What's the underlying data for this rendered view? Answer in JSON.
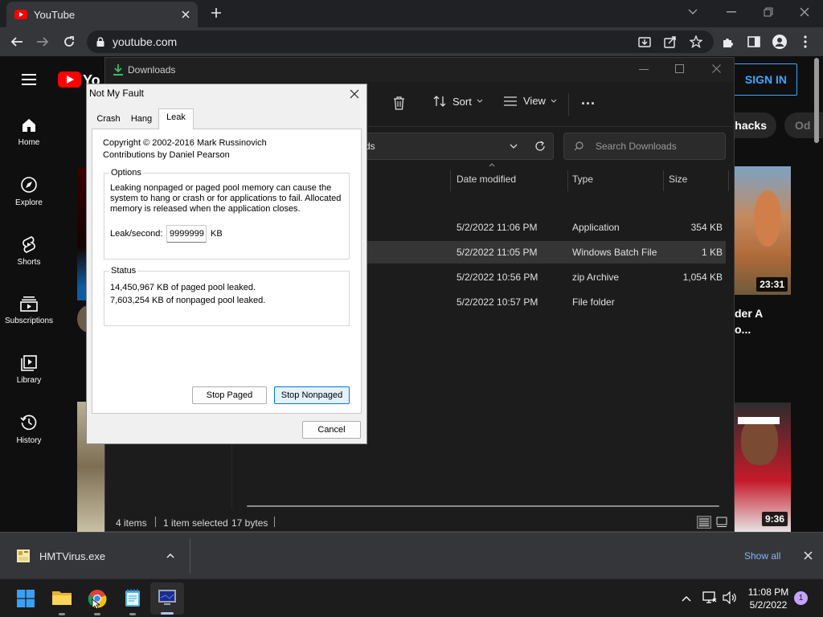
{
  "chrome": {
    "tab_title": "YouTube",
    "url": "youtube.com"
  },
  "youtube": {
    "sign_in": "SIGN IN",
    "chips": [
      "hacks",
      "Od"
    ],
    "sidebar": [
      {
        "label": "Home",
        "icon": "home-icon"
      },
      {
        "label": "Explore",
        "icon": "compass-icon"
      },
      {
        "label": "Shorts",
        "icon": "shorts-icon"
      },
      {
        "label": "Subscriptions",
        "icon": "subscriptions-icon"
      },
      {
        "label": "Library",
        "icon": "library-icon"
      },
      {
        "label": "History",
        "icon": "history-icon"
      }
    ],
    "video1": {
      "duration": "23:31",
      "title_line1": "der A",
      "title_line2": "o..."
    },
    "video2": {
      "duration": "9:36"
    }
  },
  "explorer": {
    "title": "Downloads",
    "cmd": {
      "sort": "Sort",
      "view": "View",
      "more": "..."
    },
    "address_tail": "ds",
    "search_placeholder": "Search Downloads",
    "columns": {
      "date": "Date modified",
      "type": "Type",
      "size": "Size"
    },
    "rows": [
      {
        "date": "5/2/2022 11:06 PM",
        "type": "Application",
        "size": "354 KB",
        "selected": false
      },
      {
        "date": "5/2/2022 11:05 PM",
        "type": "Windows Batch File",
        "size": "1 KB",
        "selected": true
      },
      {
        "date": "5/2/2022 10:56 PM",
        "type": "zip Archive",
        "size": "1,054 KB",
        "selected": false
      },
      {
        "date": "5/2/2022 10:57 PM",
        "type": "File folder",
        "size": "",
        "selected": false
      }
    ],
    "status": {
      "items": "4 items",
      "selected": "1 item selected",
      "bytes": "17 bytes"
    }
  },
  "dialog": {
    "title": "Not My Fault",
    "tabs": [
      "Crash",
      "Hang",
      "Leak"
    ],
    "active_tab": "Leak",
    "copyright": "Copyright © 2002-2016 Mark Russinovich",
    "contributions": "Contributions by Daniel Pearson",
    "options_label": "Options",
    "options_text": "Leaking nonpaged or paged pool memory can cause the system to hang or crash or for applications to fail. Allocated memory is released when the application closes.",
    "leak_label": "Leak/second:",
    "leak_value": "9999999",
    "leak_unit": "KB",
    "status_label": "Status",
    "status_line1": "14,450,967 KB of paged pool leaked.",
    "status_line2": "7,603,254 KB of nonpaged pool leaked.",
    "stop_paged": "Stop Paged",
    "stop_nonpaged": "Stop Nonpaged",
    "cancel": "Cancel"
  },
  "downloads_bar": {
    "file": "HMTVirus.exe",
    "show_all": "Show all"
  },
  "taskbar": {
    "time": "11:08 PM",
    "date": "5/2/2022",
    "notification_count": "1"
  },
  "colors": {
    "yt_red": "#ff0000",
    "link_blue": "#3ea6ff",
    "focus_blue": "#0078d7"
  }
}
